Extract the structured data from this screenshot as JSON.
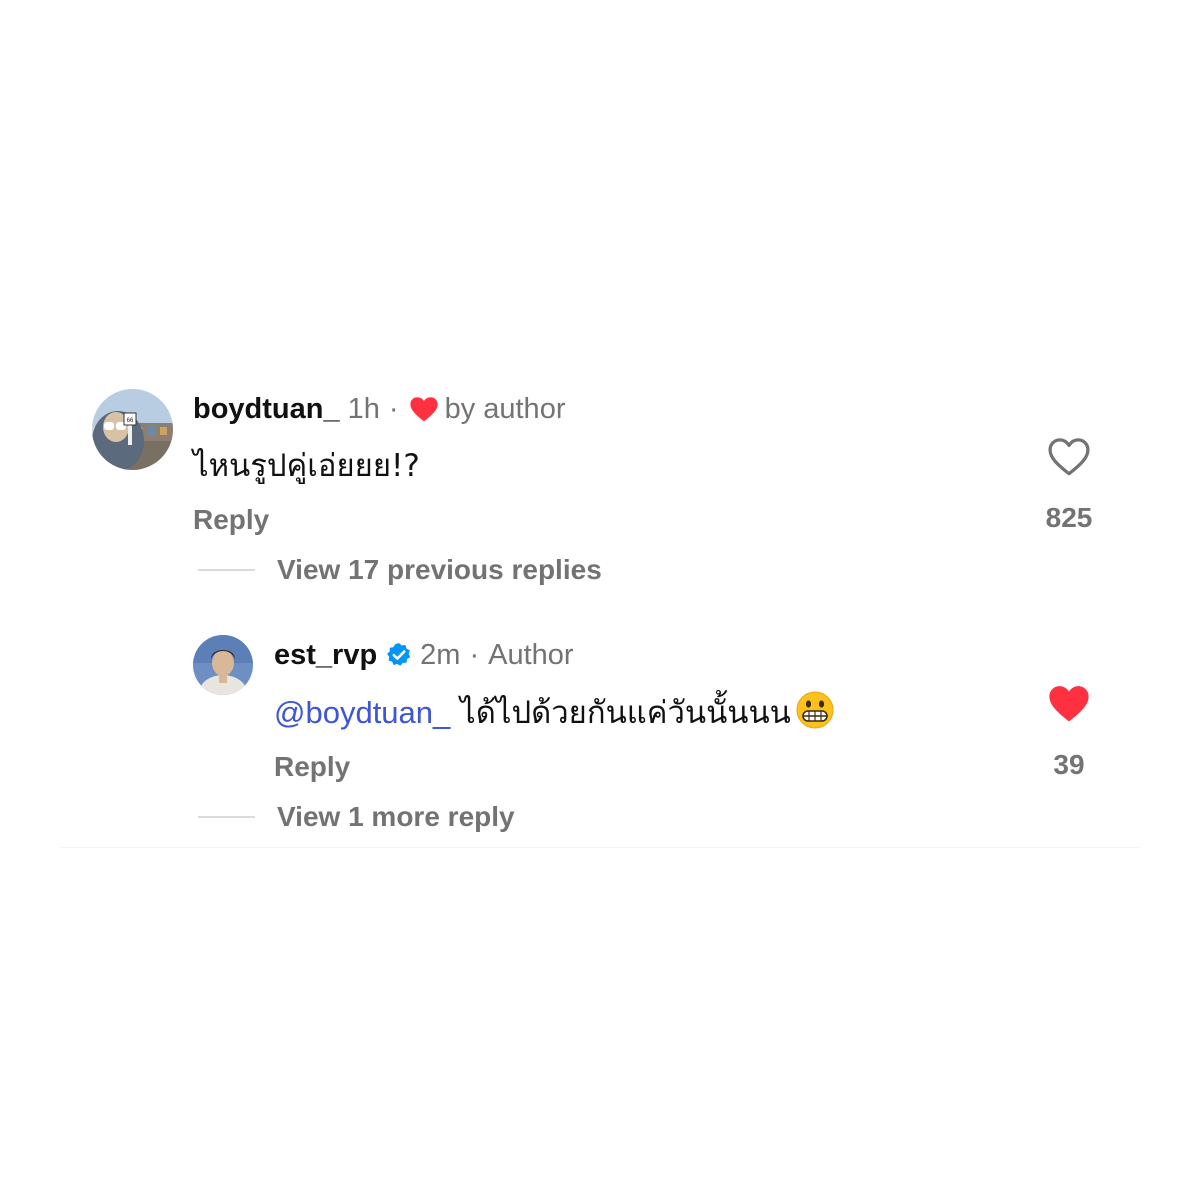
{
  "comment": {
    "username": "boydtuan_",
    "time": "1h",
    "separator": "·",
    "liked_by_author_label": "by author",
    "text": "ไหนรูปคู่เอ่ยยย!?",
    "reply_label": "Reply",
    "like_count": "825",
    "liked": false,
    "view_replies_label": "View 17 previous replies"
  },
  "reply": {
    "username": "est_rvp",
    "verified": true,
    "time": "2m",
    "separator": "·",
    "author_label": "Author",
    "mention": "@boydtuan_",
    "text": " ได้ไปด้วยกันแค่วันนั้นนน",
    "emoji_icon": "grimacing-face-icon",
    "reply_label": "Reply",
    "like_count": "39",
    "liked": true,
    "view_more_label": "View 1 more reply"
  },
  "colors": {
    "heart_red": "#ff3040",
    "verified_blue": "#0095f6",
    "mention_blue": "#3d55d6",
    "secondary_text": "#737373"
  }
}
